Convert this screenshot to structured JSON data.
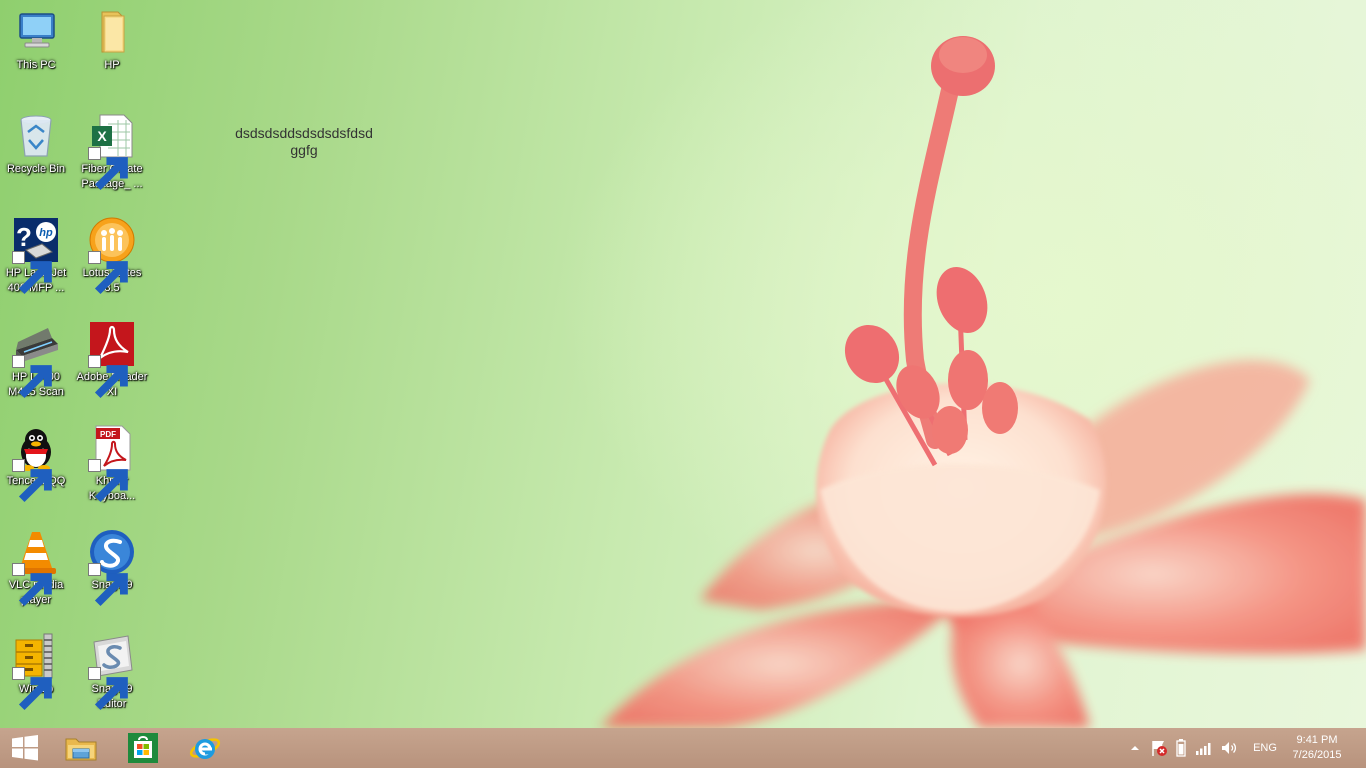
{
  "desktop": {
    "icons": [
      {
        "label": "This PC",
        "icon": "this-pc-icon"
      },
      {
        "label": "HP",
        "icon": "folder-icon"
      },
      {
        "label": "Recycle Bin",
        "icon": "recycle-bin-icon"
      },
      {
        "label": "Fiber Create Package_ ...",
        "icon": "excel-file-icon"
      },
      {
        "label": "HP LaserJet 400 MFP ...",
        "icon": "hp-help-icon"
      },
      {
        "label": "Lotus Notes 8.5",
        "icon": "lotus-notes-icon"
      },
      {
        "label": "HP LJ400 M425 Scan",
        "icon": "scanner-icon"
      },
      {
        "label": "Adobe Reader XI",
        "icon": "adobe-reader-icon"
      },
      {
        "label": "Tencent QQ",
        "icon": "qq-penguin-icon"
      },
      {
        "label": "Khmer Keyboa...",
        "icon": "pdf-file-icon"
      },
      {
        "label": "VLC media player",
        "icon": "vlc-cone-icon"
      },
      {
        "label": "SnagIt 9",
        "icon": "snagit-icon"
      },
      {
        "label": "WinZip",
        "icon": "winzip-icon"
      },
      {
        "label": "SnagIt 9 Editor",
        "icon": "snagit-editor-icon"
      }
    ],
    "note_line1": "dsdsdsddsdsdsdsfdsd",
    "note_line2": "ggfg"
  },
  "taskbar": {
    "pinned": [
      "start-icon",
      "file-explorer-icon",
      "store-icon",
      "internet-explorer-icon"
    ],
    "tray": {
      "icons": [
        "show-hidden-icons-chevron",
        "action-center-flag-icon",
        "battery-icon",
        "network-signal-icon",
        "volume-icon"
      ],
      "language": "ENG",
      "time": "9:41 PM",
      "date": "7/26/2015"
    }
  },
  "colors": {
    "taskbar": "#bb977f",
    "wallpaper_left": "#8fcf6e",
    "wallpaper_right": "#e9f7dc",
    "flower": "#f07a6e"
  }
}
